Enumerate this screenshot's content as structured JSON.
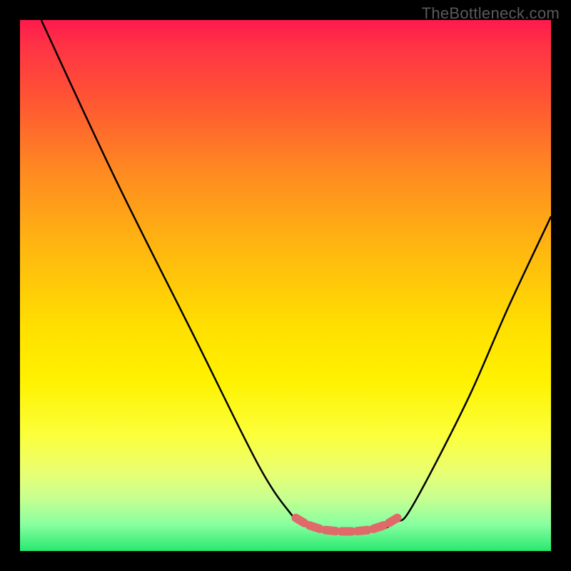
{
  "watermark": "TheBottleneck.com",
  "chart_data": {
    "type": "line",
    "title": "",
    "xlabel": "",
    "ylabel": "",
    "x_range_pct": [
      0,
      100
    ],
    "y_range_pct": [
      0,
      100
    ],
    "series": [
      {
        "name": "bottleneck-curve",
        "description": "V-shaped curve plotted over a vertical red-to-green gradient. X and Y are given as percent of plot width/height with Y=0 at top.",
        "points_pct": [
          [
            4,
            0
          ],
          [
            18,
            30
          ],
          [
            33,
            60
          ],
          [
            45,
            84
          ],
          [
            51,
            93
          ],
          [
            53,
            94.5
          ],
          [
            56,
            96
          ],
          [
            60,
            96.5
          ],
          [
            64,
            96.5
          ],
          [
            68,
            96
          ],
          [
            71,
            94.5
          ],
          [
            73,
            93
          ],
          [
            78,
            84
          ],
          [
            85,
            70
          ],
          [
            92,
            54
          ],
          [
            100,
            37
          ]
        ]
      },
      {
        "name": "valley-capsule-markers",
        "description": "Short salmon capsule segments tracing the flat valley floor of the curve.",
        "points_pct": [
          [
            51.5,
            93.5
          ],
          [
            54,
            95
          ],
          [
            57,
            96
          ],
          [
            60,
            96.3
          ],
          [
            63,
            96.3
          ],
          [
            66,
            96
          ],
          [
            69,
            95
          ],
          [
            71.5,
            93.5
          ]
        ]
      }
    ],
    "colors": {
      "curve_stroke": "#000000",
      "markers": "#e06a6a",
      "gradient_top": "#ff1a4d",
      "gradient_bottom": "#28e870",
      "background": "#000000"
    }
  }
}
